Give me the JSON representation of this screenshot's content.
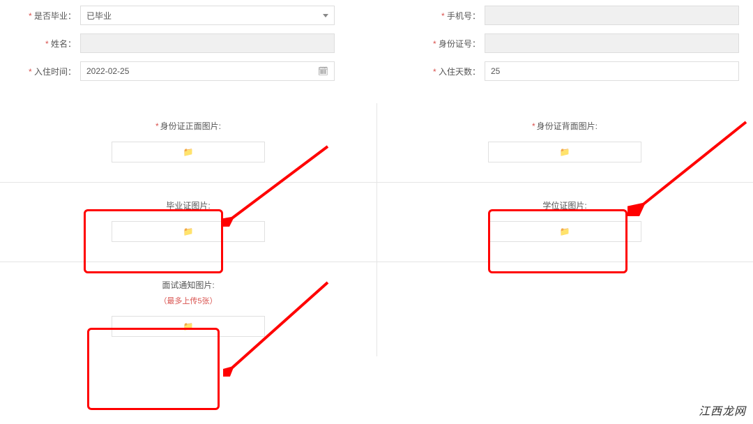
{
  "form": {
    "graduated": {
      "label": "是否毕业：",
      "value": "已毕业"
    },
    "phone": {
      "label": "手机号：",
      "value": ""
    },
    "name": {
      "label": "姓名：",
      "value": ""
    },
    "idnum": {
      "label": "身份证号：",
      "value": ""
    },
    "checkin": {
      "label": "入住时间：",
      "value": "2022-02-25"
    },
    "days": {
      "label": "入住天数：",
      "value": "25"
    }
  },
  "uploads": {
    "id_front": {
      "label": "身份证正面图片:",
      "required": true
    },
    "id_back": {
      "label": "身份证背面图片:",
      "required": true
    },
    "grad_cert": {
      "label": "毕业证图片:"
    },
    "degree": {
      "label": "学位证图片:"
    },
    "interview": {
      "label": "面试通知图片:",
      "note": "（最多上传5张）"
    }
  },
  "icons": {
    "folder": "📁"
  },
  "watermark": "江西龙网"
}
